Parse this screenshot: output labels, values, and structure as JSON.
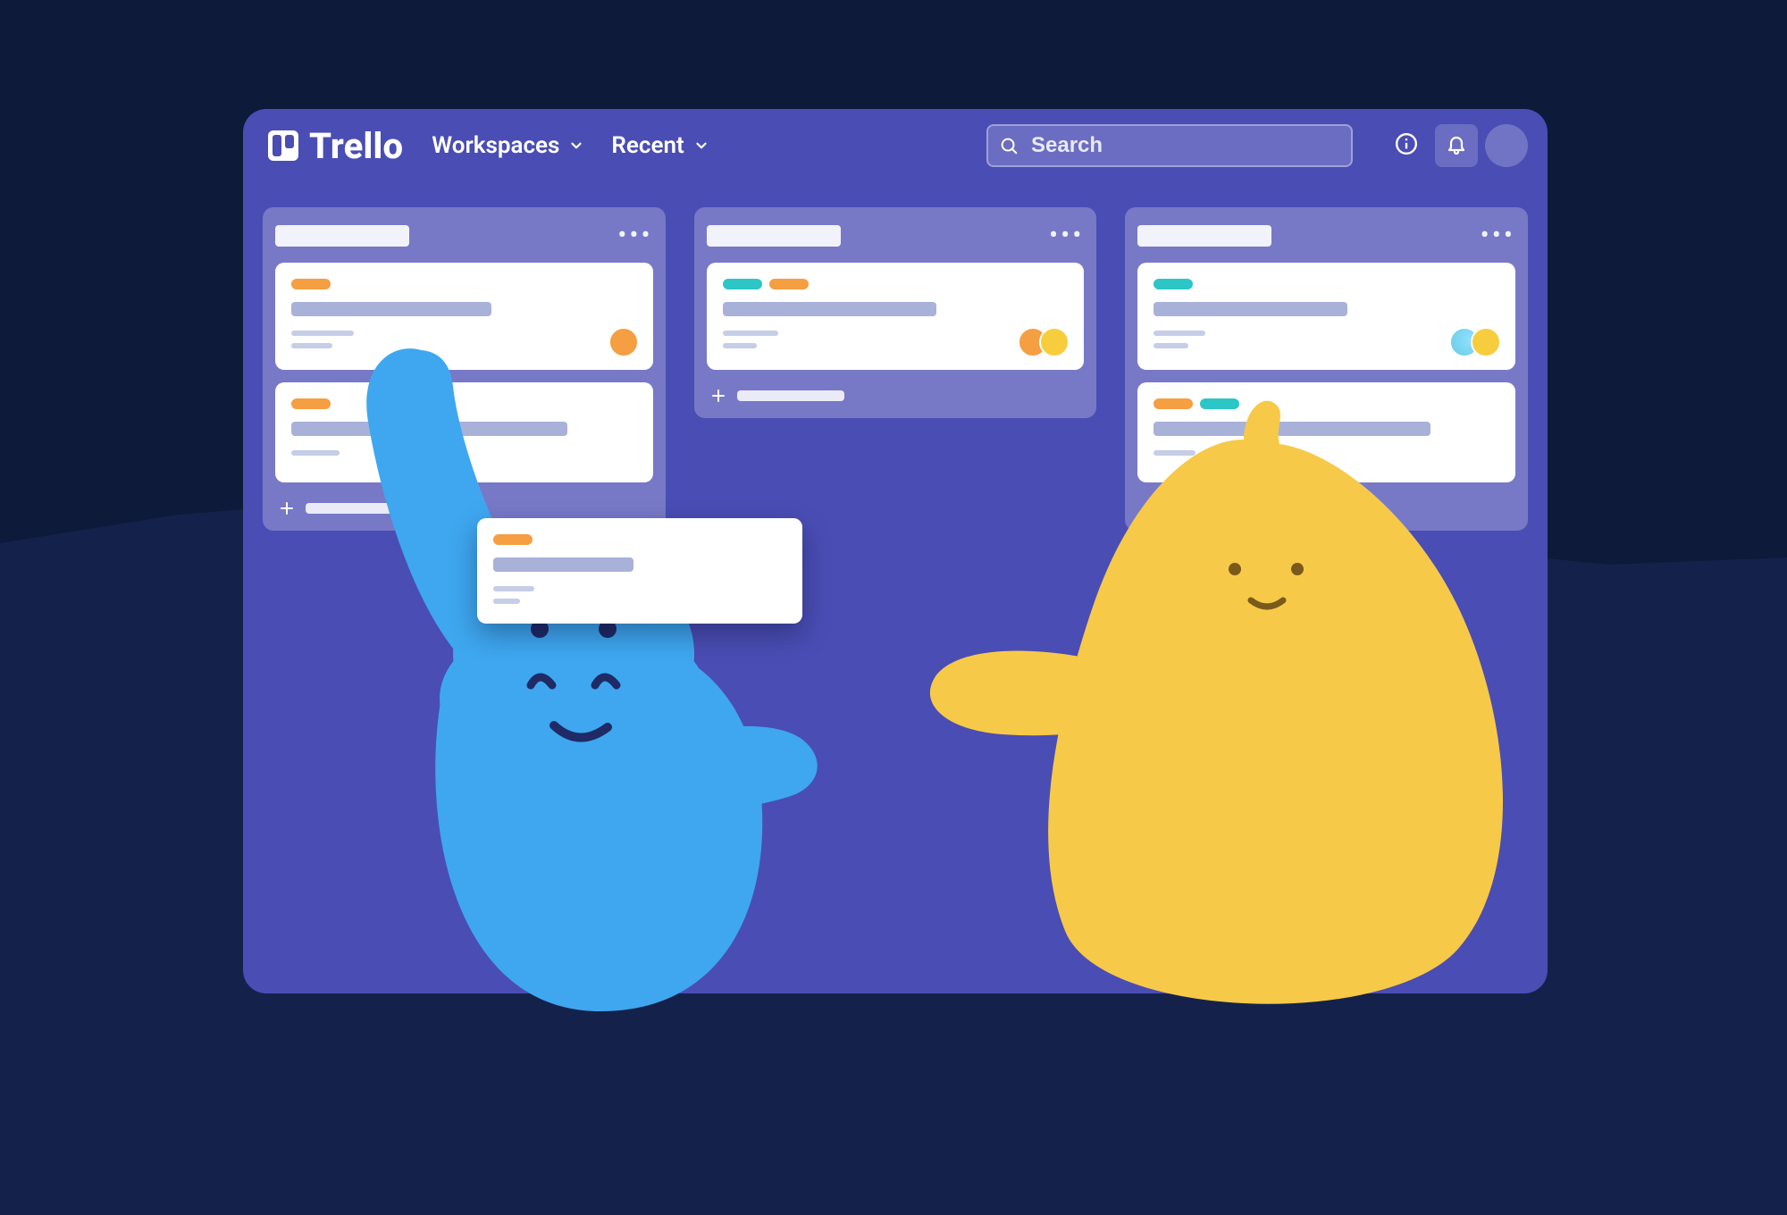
{
  "colors": {
    "page_bg": "#0e1a3a",
    "wave_bg": "#14224b",
    "window_bg": "#4a4db4",
    "list_bg": "rgba(255,255,255,0.25)",
    "card_bg": "#ffffff",
    "label_orange": "#f59e42",
    "label_teal": "#2cc6c6",
    "hippo": "#3ea7ef",
    "blob": "#f7c948"
  },
  "app": {
    "name": "Trello"
  },
  "nav": {
    "items": [
      {
        "label": "Workspaces"
      },
      {
        "label": "Recent"
      }
    ]
  },
  "search": {
    "placeholder": "Search"
  },
  "header": {
    "info_icon": "info-icon",
    "bell_icon": "bell-icon",
    "avatar": "avatar"
  },
  "lists": [
    {
      "id": "list-1",
      "cards": [
        {
          "labels": [
            "orange"
          ],
          "members": [
            "hippo-b"
          ]
        },
        {
          "labels": [
            "orange"
          ],
          "members": []
        }
      ]
    },
    {
      "id": "list-2",
      "cards": [
        {
          "labels": [
            "teal",
            "orange"
          ],
          "members": [
            "hippo-b",
            "blob-a"
          ]
        }
      ]
    },
    {
      "id": "list-3",
      "cards": [
        {
          "labels": [
            "teal"
          ],
          "members": [
            "blob-b",
            "blob-a"
          ]
        },
        {
          "labels": [
            "orange",
            "teal"
          ],
          "members": []
        }
      ]
    }
  ],
  "floating_card": {
    "labels": [
      "orange"
    ]
  }
}
